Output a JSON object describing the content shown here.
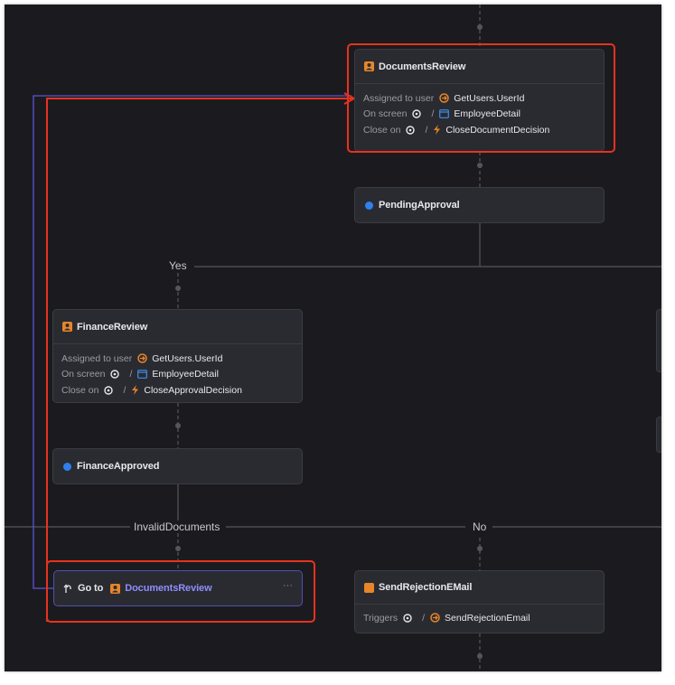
{
  "nodes": {
    "documents_review": {
      "title": "DocumentsReview",
      "assigned_label": "Assigned to user",
      "assigned_value": "GetUsers.UserId",
      "screen_label": "On screen",
      "screen_value": "EmployeeDetail",
      "close_label": "Close on",
      "close_value": "CloseDocumentDecision",
      "separator": "/"
    },
    "pending_approval": {
      "title": "PendingApproval"
    },
    "finance_review": {
      "title": "FinanceReview",
      "assigned_label": "Assigned to user",
      "assigned_value": "GetUsers.UserId",
      "screen_label": "On screen",
      "screen_value": "EmployeeDetail",
      "close_label": "Close on",
      "close_value": "CloseApprovalDecision",
      "separator": "/"
    },
    "finance_approved": {
      "title": "FinanceApproved"
    },
    "goto": {
      "prefix": "Go to",
      "target": "DocumentsReview",
      "menu": "···"
    },
    "send_rejection": {
      "title": "SendRejectionEMail",
      "triggers_label": "Triggers",
      "triggers_value": "SendRejectionEmail",
      "separator": "/"
    }
  },
  "edge_labels": {
    "yes": "Yes",
    "invalid_documents": "InvalidDocuments",
    "no": "No"
  },
  "colors": {
    "canvas": "#1b1b1f",
    "node": "#2a2b30",
    "human_activity": "#e8852a",
    "status_dot": "#2f80ed",
    "highlight": "#e8321e",
    "goto_link": "#5a55d6"
  },
  "icons": {
    "human_activity": "user-task-icon",
    "status": "status-dot-icon",
    "action": "action-call-icon",
    "screen": "screen-window-icon",
    "event": "lightning-icon",
    "goto": "goto-arrow-icon",
    "automatic_activity": "automatic-activity-icon"
  }
}
